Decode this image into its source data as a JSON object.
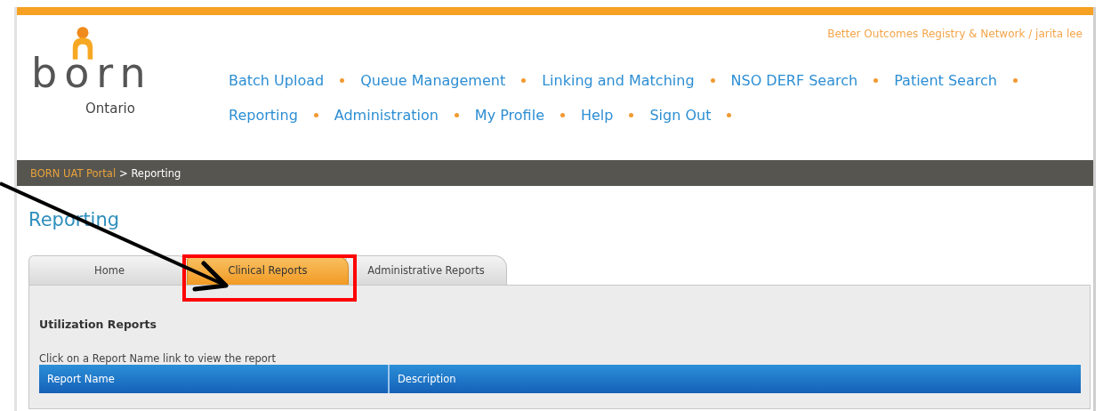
{
  "header": {
    "logo": {
      "word": "born",
      "region": "Ontario"
    },
    "org_user": "Better Outcomes Registry & Network / jarita lee"
  },
  "nav": [
    [
      "Batch Upload",
      "Queue Management",
      "Linking and Matching",
      "NSO DERF Search",
      "Patient Search"
    ],
    [
      "Reporting",
      "Administration",
      "My Profile",
      "Help",
      "Sign Out"
    ]
  ],
  "breadcrumb": {
    "link": "BORN UAT Portal",
    "current": "> Reporting"
  },
  "title": "Reporting",
  "tabs": [
    {
      "label": "Home",
      "selected": false
    },
    {
      "label": "Clinical Reports",
      "selected": true
    },
    {
      "label": "Administrative Reports",
      "selected": false
    }
  ],
  "section": "Utilization Reports",
  "instruction": "Click on a Report Name link to view the report",
  "table": {
    "columns": [
      "Report Name",
      "Description"
    ]
  }
}
